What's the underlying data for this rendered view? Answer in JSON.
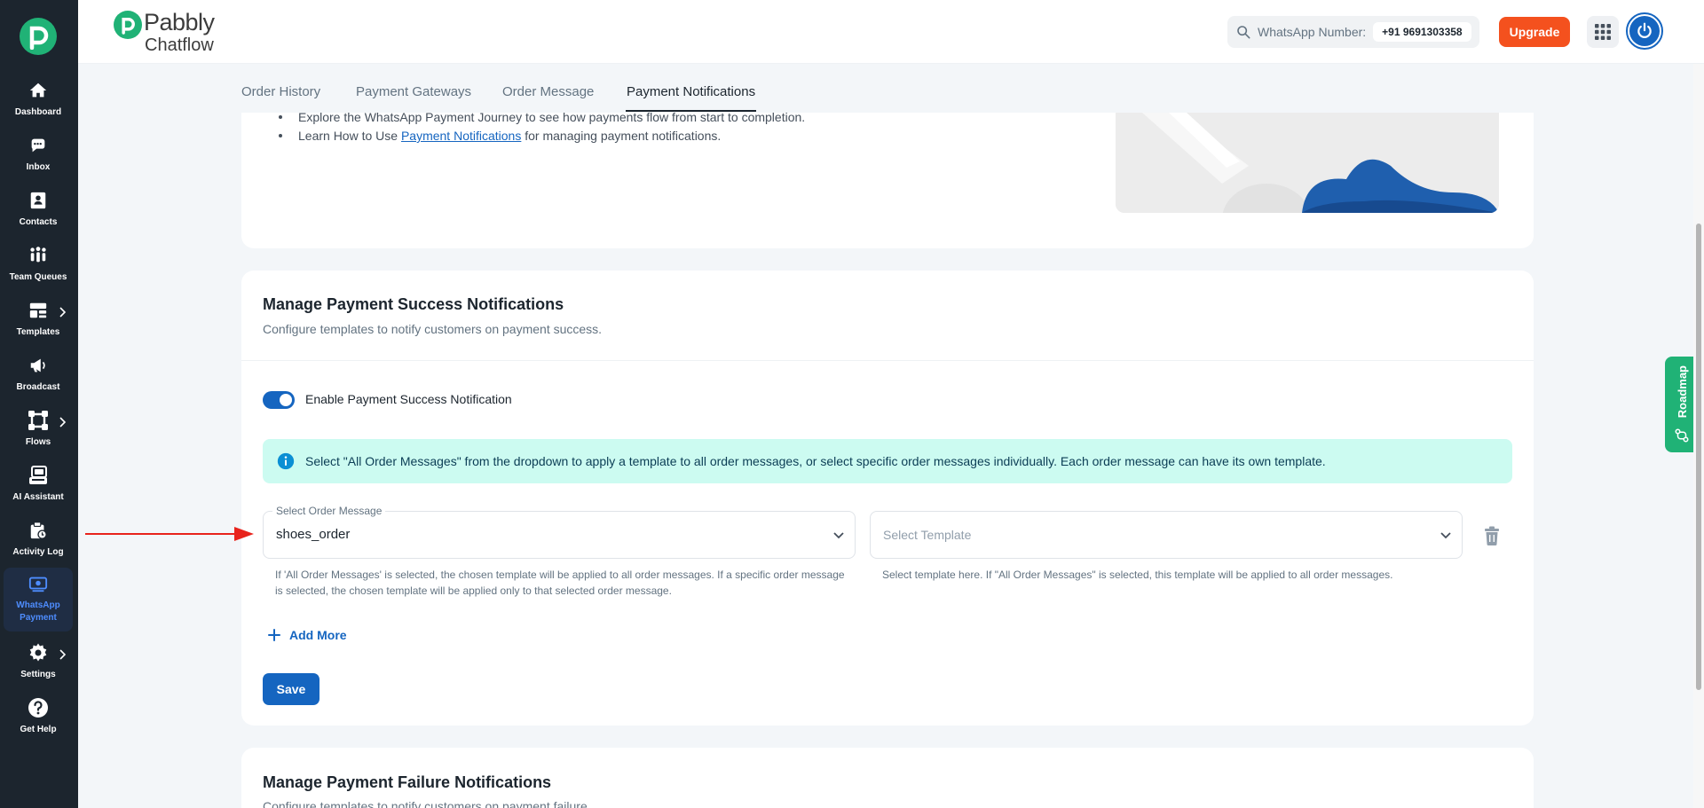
{
  "sidebar": {
    "items": [
      {
        "label": "Dashboard",
        "icon": "home-icon"
      },
      {
        "label": "Inbox",
        "icon": "chat-icon"
      },
      {
        "label": "Contacts",
        "icon": "contacts-icon"
      },
      {
        "label": "Team Queues",
        "icon": "team-icon"
      },
      {
        "label": "Templates",
        "icon": "templates-icon"
      },
      {
        "label": "Broadcast",
        "icon": "megaphone-icon"
      },
      {
        "label": "Flows",
        "icon": "flows-icon"
      },
      {
        "label": "AI Assistant",
        "icon": "robot-icon"
      },
      {
        "label": "Activity Log",
        "icon": "clipboard-icon"
      },
      {
        "label": "WhatsApp Payment",
        "icon": "payment-icon"
      },
      {
        "label": "Settings",
        "icon": "gear-icon"
      },
      {
        "label": "Get Help",
        "icon": "help-icon"
      }
    ],
    "active": "WhatsApp Payment"
  },
  "header": {
    "brand_name": "Pabbly",
    "brand_sub": "Chatflow",
    "whatsapp_label": "WhatsApp Number:",
    "whatsapp_number": "+91 9691303358",
    "upgrade_label": "Upgrade"
  },
  "tabs": [
    {
      "label": "Order History"
    },
    {
      "label": "Payment Gateways"
    },
    {
      "label": "Order Message"
    },
    {
      "label": "Payment Notifications"
    }
  ],
  "active_tab": "Payment Notifications",
  "intro": {
    "bullet1": "Explore the WhatsApp Payment Journey to see how payments flow from start to completion.",
    "bullet2_prefix": "Learn How to Use ",
    "bullet2_link": "Payment Notifications",
    "bullet2_suffix": " for managing payment notifications."
  },
  "success": {
    "title": "Manage Payment Success Notifications",
    "subtitle": "Configure templates to notify customers on payment success.",
    "toggle_label": "Enable Payment Success Notification",
    "toggle_on": true,
    "info": "Select \"All Order Messages\" from the dropdown to apply a template to all order messages, or select specific order messages individually. Each order message can have its own template.",
    "order_field_label": "Select Order Message",
    "order_field_value": "shoes_order",
    "order_helper": "If 'All Order Messages' is selected, the chosen template will be applied to all order messages. If a specific order message is selected, the chosen template will be applied only to that selected order message.",
    "template_placeholder": "Select Template",
    "template_helper": "Select template here. If \"All Order Messages\" is selected, this template will be applied to all order messages.",
    "add_more_label": "Add More",
    "save_label": "Save"
  },
  "failure": {
    "title": "Manage Payment Failure Notifications",
    "subtitle": "Configure templates to notify customers on payment failure."
  },
  "roadmap_label": "Roadmap",
  "colors": {
    "sidebar_bg": "#1c252e",
    "brand_green": "#20b276",
    "primary": "#1565c0",
    "upgrade": "#f4511e",
    "info_bg": "#ccfbf1",
    "annotation_arrow": "#e8231c"
  }
}
